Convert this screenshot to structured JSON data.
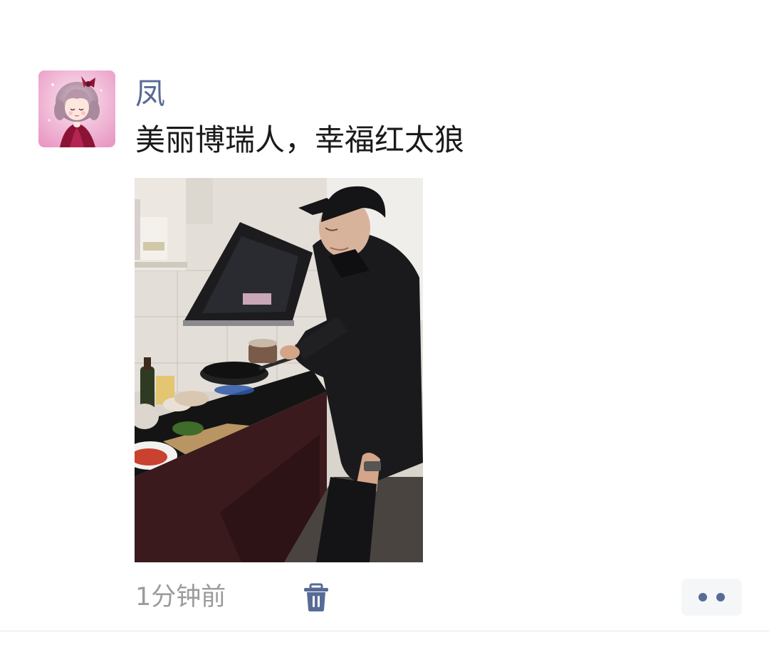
{
  "post": {
    "author": "凤",
    "text": "美丽博瑞人，幸福红太狼",
    "timestamp": "1分钟前"
  },
  "icons": {
    "avatar": "cartoon-girl-avatar",
    "delete": "trash-icon",
    "more": "more-dots-icon"
  },
  "colors": {
    "author_link": "#576b95",
    "text": "#1a1a1a",
    "meta": "#9b9b9b"
  }
}
